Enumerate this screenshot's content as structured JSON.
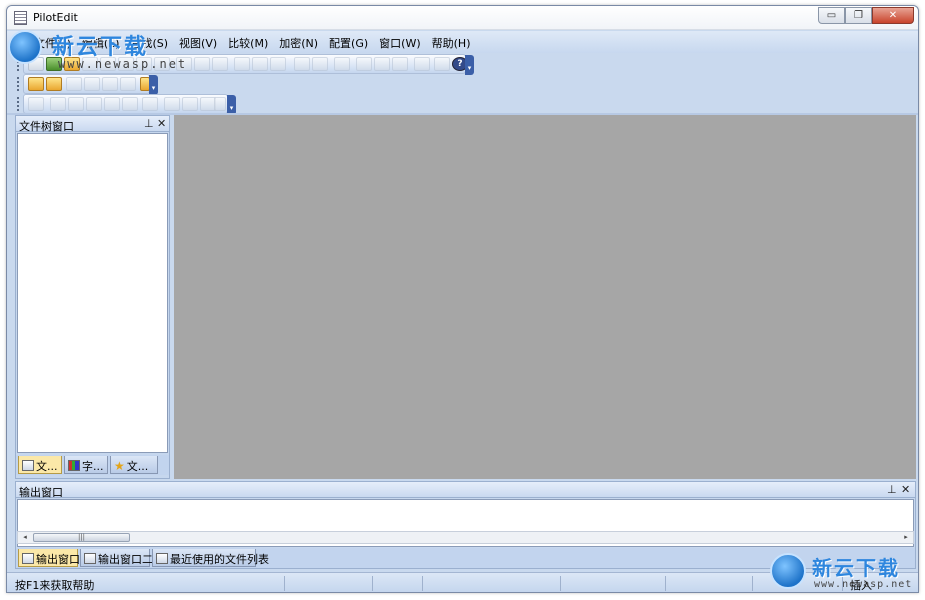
{
  "window": {
    "title": "PilotEdit",
    "minimize_glyph": "▭",
    "maximize_glyph": "❐",
    "close_glyph": "✕"
  },
  "menu": {
    "items": [
      "文件(F)",
      "编辑(E)",
      "查找(S)",
      "视图(V)",
      "比较(M)",
      "加密(N)",
      "配置(G)",
      "窗口(W)",
      "帮助(H)"
    ]
  },
  "toolbars": {
    "help_glyph": "?",
    "overflow_glyph": "▾"
  },
  "file_tree_pane": {
    "title": "文件树窗口",
    "pin_glyph": "⊥",
    "close_glyph": "✕",
    "tabs": [
      {
        "label": "文...",
        "icon": "file-tree-icon",
        "active": true
      },
      {
        "label": "字...",
        "icon": "chart-icon",
        "active": false
      },
      {
        "label": "文...",
        "icon": "star-icon",
        "active": false
      }
    ]
  },
  "output_pane": {
    "title": "输出窗口",
    "pin_glyph": "⊥",
    "close_glyph": "✕",
    "scroll_left": "◂",
    "scroll_right": "▸",
    "scroll_thumb_grip": "|||",
    "tabs": [
      {
        "label": "输出窗口",
        "icon": "output-icon",
        "active": true
      },
      {
        "label": "输出窗口二",
        "icon": "output-icon",
        "active": false
      },
      {
        "label": "最近使用的文件列表",
        "icon": "recent-files-icon",
        "active": false
      }
    ]
  },
  "statusbar": {
    "help_text": "按F1来获取帮助",
    "mode": "插入"
  },
  "watermark": {
    "title": "新云下载",
    "url": "www.newasp.net"
  },
  "colors": {
    "workspace": "#a6a6a6",
    "chrome": "#c9d9ee",
    "active_tab": "#fbe8a8"
  }
}
